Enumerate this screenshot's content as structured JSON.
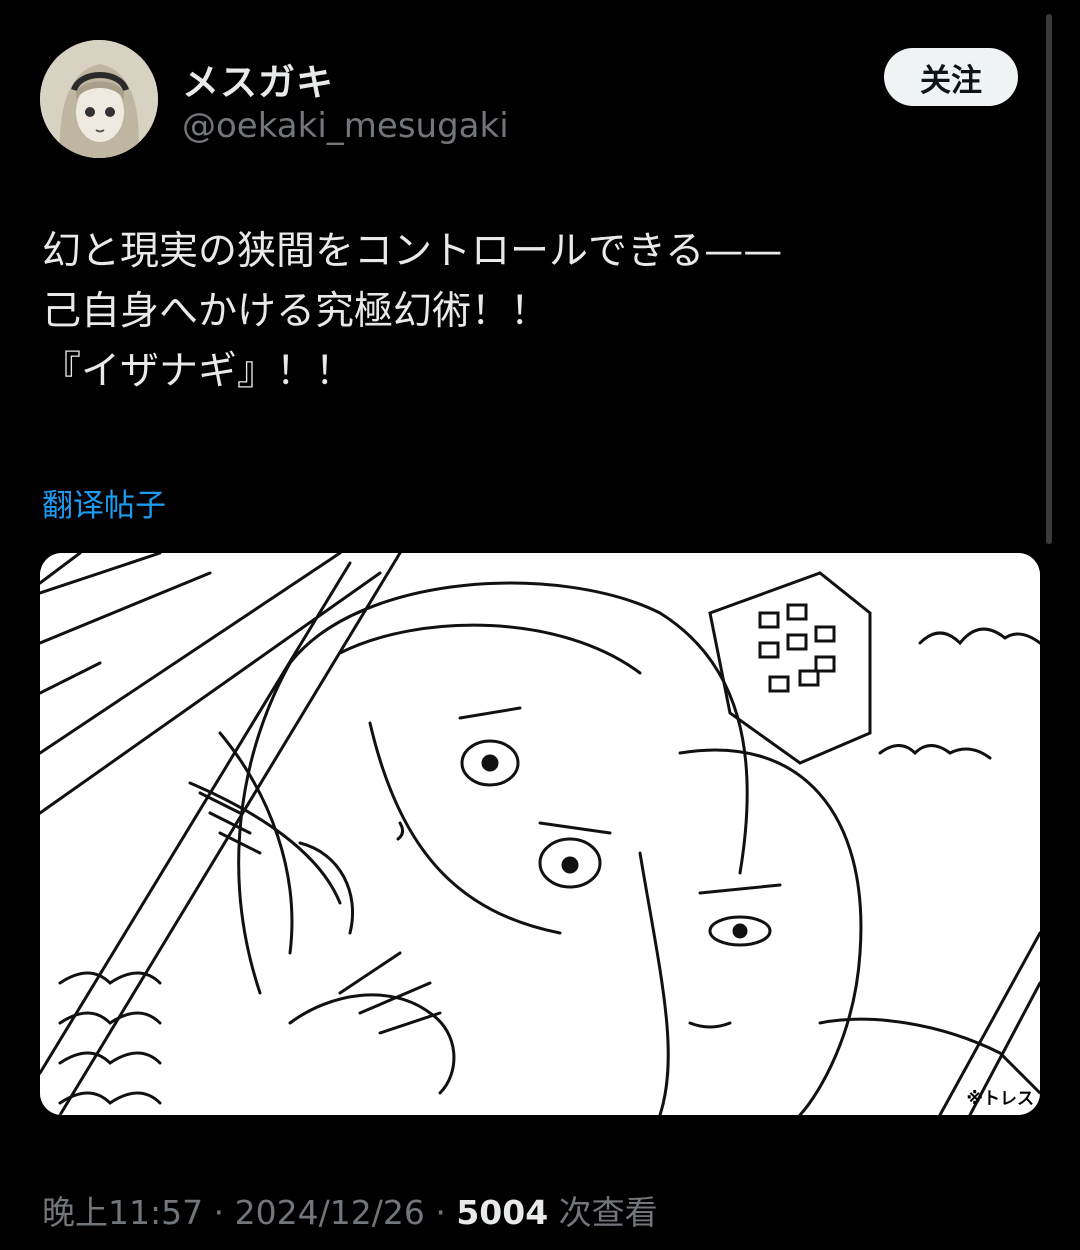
{
  "author": {
    "display_name": "メスガキ",
    "handle": "@oekaki_mesugaki"
  },
  "follow_button": {
    "label": "关注"
  },
  "tweet": {
    "lines": [
      "幻と現実の狭間をコントロールできる——",
      "己自身へかける究極幻術！！",
      "『イザナギ』！！"
    ]
  },
  "translate_link": "翻译帖子",
  "media": {
    "corner_note": "※トレス"
  },
  "meta": {
    "time": "晚上11:57",
    "separator": "·",
    "date": "2024/12/26",
    "views_count": "5004",
    "views_label": "次查看"
  }
}
